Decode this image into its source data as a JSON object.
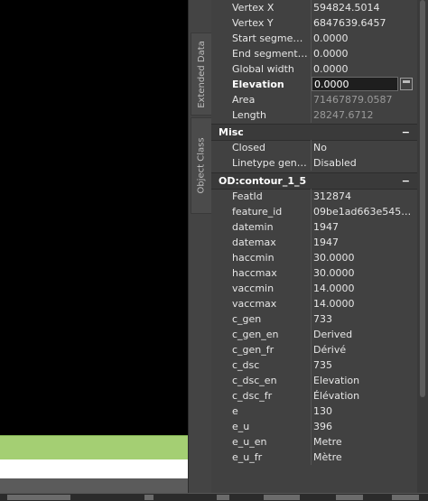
{
  "side_tabs": {
    "extended_data": "Extended Data",
    "object_class": "Object Class"
  },
  "geometry_rows": [
    {
      "label": "Vertex X",
      "value": "594824.5014"
    },
    {
      "label": "Vertex Y",
      "value": "6847639.6457"
    },
    {
      "label": "Start segment...",
      "value": "0.0000"
    },
    {
      "label": "End segment wi...",
      "value": "0.0000"
    },
    {
      "label": "Global width",
      "value": "0.0000"
    },
    {
      "label": "Elevation",
      "value": "0.0000"
    },
    {
      "label": "Area",
      "value": "71467879.0587"
    },
    {
      "label": "Length",
      "value": "28247.6712"
    }
  ],
  "misc": {
    "title": "Misc",
    "collapse": "−",
    "rows": [
      {
        "label": "Closed",
        "value": "No"
      },
      {
        "label": "Linetype genera...",
        "value": "Disabled"
      }
    ]
  },
  "od": {
    "title": "OD:contour_1_5",
    "collapse": "−",
    "rows": [
      {
        "label": "FeatId",
        "value": "312874"
      },
      {
        "label": "feature_id",
        "value": "09be1ad663e54540..."
      },
      {
        "label": "datemin",
        "value": "1947"
      },
      {
        "label": "datemax",
        "value": "1947"
      },
      {
        "label": "haccmin",
        "value": "30.0000"
      },
      {
        "label": "haccmax",
        "value": "30.0000"
      },
      {
        "label": "vaccmin",
        "value": "14.0000"
      },
      {
        "label": "vaccmax",
        "value": "14.0000"
      },
      {
        "label": "c_gen",
        "value": "733"
      },
      {
        "label": "c_gen_en",
        "value": "Derived"
      },
      {
        "label": "c_gen_fr",
        "value": "Dérivé"
      },
      {
        "label": "c_dsc",
        "value": "735"
      },
      {
        "label": "c_dsc_en",
        "value": "Elevation"
      },
      {
        "label": "c_dsc_fr",
        "value": "Élévation"
      },
      {
        "label": "e",
        "value": "130"
      },
      {
        "label": "e_u",
        "value": "396"
      },
      {
        "label": "e_u_en",
        "value": "Metre"
      },
      {
        "label": "e_u_fr",
        "value": "Mètre"
      }
    ]
  }
}
